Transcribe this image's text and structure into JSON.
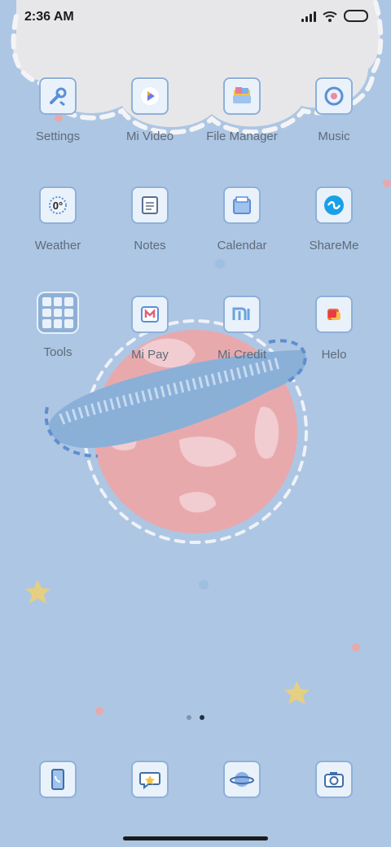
{
  "status_bar": {
    "time": "2:36 AM"
  },
  "apps_row1": [
    {
      "label": "Settings",
      "icon": "settings-icon"
    },
    {
      "label": "Mi Video",
      "icon": "mi-video-icon"
    },
    {
      "label": "File Manager",
      "icon": "file-manager-icon"
    },
    {
      "label": "Music",
      "icon": "music-icon"
    }
  ],
  "apps_row2": [
    {
      "label": "Weather",
      "icon": "weather-icon",
      "badge": "0°"
    },
    {
      "label": "Notes",
      "icon": "notes-icon"
    },
    {
      "label": "Calendar",
      "icon": "calendar-icon"
    },
    {
      "label": "ShareMe",
      "icon": "shareme-icon"
    }
  ],
  "apps_row3": [
    {
      "label": "Tools",
      "icon": "folder-icon"
    },
    {
      "label": "Mi Pay",
      "icon": "mi-pay-icon"
    },
    {
      "label": "Mi Credit",
      "icon": "mi-credit-icon"
    },
    {
      "label": "Helo",
      "icon": "helo-icon"
    }
  ],
  "dock": [
    {
      "icon": "phone-icon"
    },
    {
      "icon": "messages-icon"
    },
    {
      "icon": "browser-icon"
    },
    {
      "icon": "camera-icon"
    }
  ],
  "pages": {
    "count": 2,
    "active": 2
  },
  "colors": {
    "background": "#adc6e3",
    "cloud": "#e7e7e9",
    "planet": "#e8a9ad",
    "ring": "#8ab0d8",
    "star": "#e4cf82"
  }
}
